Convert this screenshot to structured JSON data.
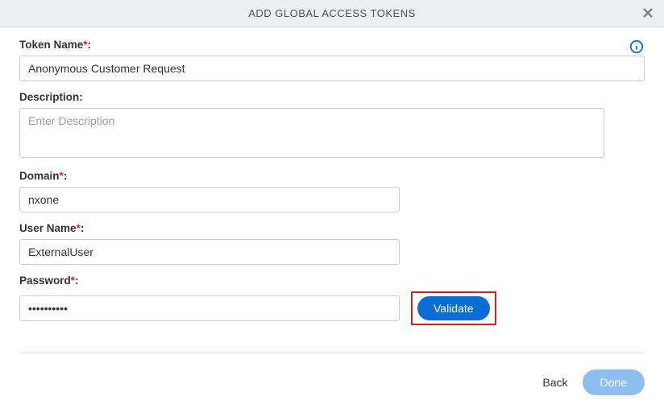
{
  "dialog": {
    "title": "ADD GLOBAL ACCESS TOKENS"
  },
  "form": {
    "tokenName": {
      "label": "Token Name",
      "value": "Anonymous Customer Request"
    },
    "description": {
      "label": "Description:",
      "placeholder": "Enter Description",
      "value": ""
    },
    "domain": {
      "label": "Domain",
      "value": "nxone"
    },
    "userName": {
      "label": "User Name",
      "value": "ExternalUser"
    },
    "password": {
      "label": "Password",
      "value": "••••••••••"
    },
    "validateLabel": "Validate"
  },
  "footer": {
    "back": "Back",
    "done": "Done"
  }
}
